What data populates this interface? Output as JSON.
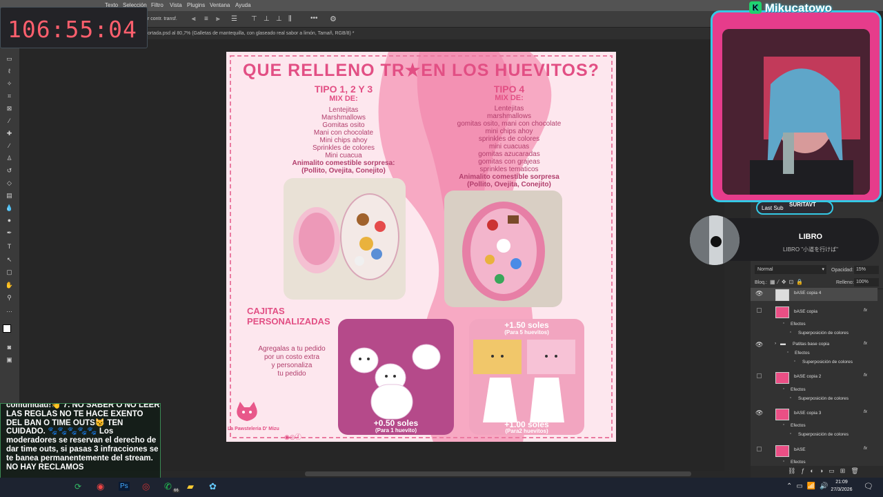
{
  "menu": {
    "items": [
      "Texto",
      "Selección",
      "Filtro",
      "Vista",
      "Plugins",
      "Ventana",
      "Ayuda"
    ]
  },
  "options": {
    "transform_label": "r contr. transf."
  },
  "tab": {
    "title": "ortada.psd al 80,7% (Galletas de mantequilla, con glaseado real sabor a limón, Tamañ, RGB/8) *"
  },
  "overlay": {
    "timer": "106:55:04",
    "brand": "Mikucatowo",
    "last_sub_label": "Last Sub",
    "last_sub_name": "SURITAVT",
    "music_title": "LIBRO",
    "music_subtitle": "LIBRO \"小道を行けば\""
  },
  "chat": {
    "message": "comunidad!👋 7. NO SABER O NO LEER LAS REGLAS NO TE HACE EXENTO DEL BAN O TIME OUTS😼 TEN CUIDADO. 🐾🐾🐾🐾🐾 Los moderadores se reservan el derecho de dar time outs, si pasas 3 infracciones se te banea permanentemente del stream. NO HAY RECLAMOS"
  },
  "doc": {
    "title": "QUE RELLENO TR★EN LOS HUEVITOS?",
    "col1": {
      "heading": "TIPO 1, 2 Y 3",
      "mix": "MIX DE:",
      "items": [
        "Lentejitas",
        "Marshmallows",
        "Gomitas osito",
        "Mani con chocolate",
        "Mini chips ahoy",
        "Sprinkles de colores",
        "Mini cuacua"
      ],
      "surprise": "Animalito comestible sorpresa:",
      "surprise_sub": "(Pollito, Ovejita, Conejito)"
    },
    "col2": {
      "heading": "TIPO 4",
      "mix": "MIX DE:",
      "items": [
        "Lentejitas",
        "marshmallows",
        "gomitas osito, mani con chocolate",
        "mini chips ahoy",
        "sprinkles de colores",
        "mini cuacuas",
        "gomitas azucaradas",
        "gomitas con grajeas",
        "sprinkles tematicos"
      ],
      "surprise": "Animalito comestible sorpresa",
      "surprise_sub": "(Pollito, Ovejita, Conejito)"
    },
    "cajitas_title": "CAJITAS PERSONALIZADAS",
    "cajitas_text": [
      "Agregalas a tu pedido",
      "por un costo extra",
      "y personaliza",
      "tu pedido"
    ],
    "price1": "+0.50 soles",
    "price1_sub": "(Para 1 huevito)",
    "price2": "+1.50 soles",
    "price2_sub": "(Para 5 huevitos)",
    "price3": "+1.00 soles",
    "price3_sub": "(Para2 huevitos)",
    "brand": "La Pawsteleria D' Mizu"
  },
  "layers_panel": {
    "blend_mode": "Normal",
    "opacity_label": "Opacidad:",
    "opacity": "15%",
    "lock_label": "Bloq.:",
    "fill_label": "Relleno:",
    "fill": "100%",
    "layers": [
      {
        "name": "bASE copia 4"
      },
      {
        "name": "bASE copia",
        "fx": "fx"
      },
      {
        "name": "Efectos"
      },
      {
        "name": "Superposición de colores"
      },
      {
        "name": "Patitas base copia",
        "fx": "fx"
      },
      {
        "name": "Efectos"
      },
      {
        "name": "Superposición de colores"
      },
      {
        "name": "bASE copia 2",
        "fx": "fx"
      },
      {
        "name": "Efectos"
      },
      {
        "name": "Superposición de colores"
      },
      {
        "name": "bASE copia 3",
        "fx": "fx"
      },
      {
        "name": "Efectos"
      },
      {
        "name": "Superposición de colores"
      },
      {
        "name": "bASE",
        "fx": "fx"
      },
      {
        "name": "Efectos"
      }
    ]
  },
  "taskbar": {
    "badge": "66",
    "time": "21:09",
    "date": "27/3/2026"
  }
}
